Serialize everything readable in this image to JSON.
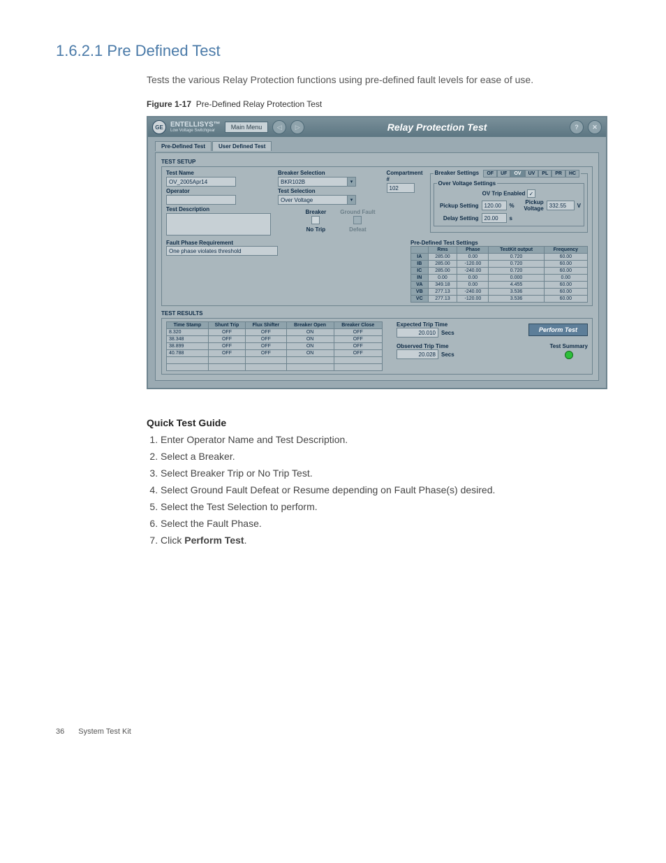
{
  "page": {
    "section_number": "1.6.2.1",
    "section_title": "Pre Defined Test",
    "intro_text": "Tests the various Relay Protection functions using pre-defined fault levels for ease of use.",
    "figure_label": "Figure 1-17",
    "figure_title": "Pre-Defined Relay Protection Test",
    "footer_page": "36",
    "footer_doc": "System Test Kit"
  },
  "app": {
    "brand": "ENTELLISYS™",
    "brand_sub": "Low Voltage Switchgear",
    "main_menu": "Main Menu",
    "title": "Relay Protection Test",
    "tabs": {
      "predef": "Pre-Defined Test",
      "userdef": "User Defined Test"
    },
    "headings": {
      "test_setup": "TEST SETUP",
      "test_results": "TEST RESULTS",
      "breaker_settings": "Breaker Settings",
      "ov_settings": "Over Voltage Settings",
      "predef_settings": "Pre-Defined Test Settings",
      "expected_trip": "Expected Trip Time",
      "observed_trip": "Observed Trip Time"
    },
    "labels": {
      "test_name": "Test Name",
      "breaker_selection": "Breaker Selection",
      "compartment": "Compartment #",
      "operator": "Operator",
      "test_selection": "Test Selection",
      "test_description": "Test Description",
      "breaker": "Breaker",
      "ground_fault": "Ground Fault",
      "no_trip": "No Trip",
      "defeat": "Defeat",
      "fault_phase_req": "Fault Phase Requirement",
      "ov_trip_enabled": "OV Trip Enabled",
      "pickup_setting": "Pickup Setting",
      "delay_setting": "Delay Setting",
      "pickup_voltage": "Pickup Voltage",
      "secs": "Secs",
      "perform_test": "Perform Test",
      "test_summary": "Test Summary",
      "pct": "%",
      "s": "s",
      "v": "V"
    },
    "values": {
      "test_name": "OV_2005Apr14",
      "breaker_selection": "BKR102B",
      "compartment": "102",
      "test_selection": "Over Voltage",
      "fault_phase_req": "One phase violates threshold",
      "pickup_setting": "120.00",
      "delay_setting": "20.00",
      "pickup_voltage": "332.55",
      "expected_trip": "20.010",
      "observed_trip": "20.028"
    },
    "breaker_tabs": [
      "OF",
      "UF",
      "OV",
      "UV",
      "PL",
      "PR",
      "HC"
    ],
    "predef_table": {
      "cols": [
        "",
        "Rms",
        "Phase",
        "TestKit output",
        "Frequency"
      ],
      "rows": [
        [
          "IA",
          "285.00",
          "0.00",
          "0.720",
          "60.00"
        ],
        [
          "IB",
          "285.00",
          "-120.00",
          "0.720",
          "60.00"
        ],
        [
          "IC",
          "285.00",
          "-240.00",
          "0.720",
          "60.00"
        ],
        [
          "IN",
          "0.00",
          "0.00",
          "0.000",
          "0.00"
        ],
        [
          "VA",
          "349.18",
          "0.00",
          "4.455",
          "60.00"
        ],
        [
          "VB",
          "277.13",
          "-240.00",
          "3.536",
          "60.00"
        ],
        [
          "VC",
          "277.13",
          "-120.00",
          "3.536",
          "60.00"
        ]
      ]
    },
    "results_table": {
      "cols": [
        "Time Stamp",
        "Shunt Trip",
        "Flux Shifter",
        "Breaker Open",
        "Breaker Close"
      ],
      "rows": [
        [
          "8.320",
          "OFF",
          "OFF",
          "ON",
          "OFF"
        ],
        [
          "38.348",
          "OFF",
          "OFF",
          "ON",
          "OFF"
        ],
        [
          "38.899",
          "OFF",
          "OFF",
          "ON",
          "OFF"
        ],
        [
          "40.788",
          "OFF",
          "OFF",
          "ON",
          "OFF"
        ],
        [
          "",
          "",
          "",
          "",
          ""
        ],
        [
          "",
          "",
          "",
          "",
          ""
        ]
      ]
    }
  },
  "guide": {
    "title": "Quick Test Guide",
    "steps": [
      "Enter Operator Name and Test Description.",
      "Select a Breaker.",
      "Select Breaker Trip or No Trip Test.",
      "Select Ground Fault Defeat or Resume depending on Fault Phase(s) desired.",
      "Select the Test Selection to perform.",
      "Select the Fault Phase.",
      "Click "
    ],
    "step7_bold": "Perform Test"
  }
}
